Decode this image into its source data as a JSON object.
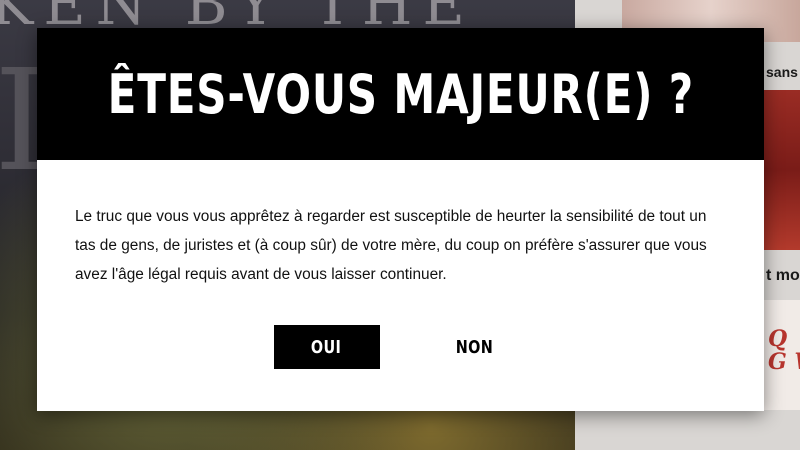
{
  "background": {
    "hero_title": "KEN BY THE",
    "hero_letter": "I",
    "sidebar_word_top": "sans",
    "sidebar_word_mid": "t moi",
    "sidebar_script": "Q\nG W"
  },
  "age_gate": {
    "title": "ÊTES-VOUS MAJEUR(E) ?",
    "message": "Le truc que vous vous apprêtez à regarder est susceptible de heurter la sensibilité de tout un tas de gens, de juristes et (à coup sûr) de votre mère, du coup on préfère s'assurer que vous avez l'âge légal requis avant de vous laisser continuer.",
    "yes_label": "OUI",
    "no_label": "NON"
  },
  "colors": {
    "header_bg": "#000000",
    "body_bg": "#ffffff",
    "primary_button_bg": "#000000",
    "primary_button_text": "#ffffff"
  }
}
